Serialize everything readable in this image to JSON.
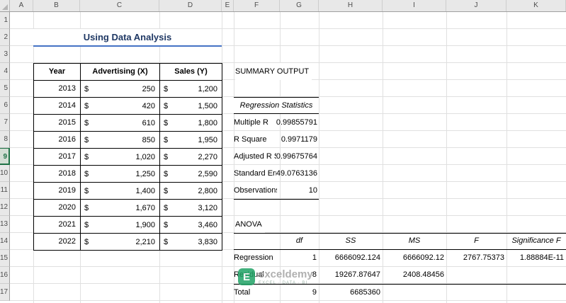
{
  "grid": {
    "columns": [
      "A",
      "B",
      "C",
      "D",
      "E",
      "F",
      "G",
      "H",
      "I",
      "J",
      "K"
    ],
    "rows": [
      "1",
      "2",
      "3",
      "4",
      "5",
      "6",
      "7",
      "8",
      "9",
      "10",
      "11",
      "12",
      "13",
      "14",
      "15",
      "16",
      "17"
    ],
    "selected_row": "9"
  },
  "title": "Using Data Analysis",
  "data_table": {
    "headers": [
      "Year",
      "Advertising (X)",
      "Sales (Y)"
    ],
    "currency": "$",
    "rows": [
      {
        "year": "2013",
        "advertising": "250",
        "sales": "1,200"
      },
      {
        "year": "2014",
        "advertising": "420",
        "sales": "1,500"
      },
      {
        "year": "2015",
        "advertising": "610",
        "sales": "1,800"
      },
      {
        "year": "2016",
        "advertising": "850",
        "sales": "1,950"
      },
      {
        "year": "2017",
        "advertising": "1,020",
        "sales": "2,270"
      },
      {
        "year": "2018",
        "advertising": "1,250",
        "sales": "2,590"
      },
      {
        "year": "2019",
        "advertising": "1,400",
        "sales": "2,800"
      },
      {
        "year": "2020",
        "advertising": "1,670",
        "sales": "3,120"
      },
      {
        "year": "2021",
        "advertising": "1,900",
        "sales": "3,460"
      },
      {
        "year": "2022",
        "advertising": "2,210",
        "sales": "3,830"
      }
    ]
  },
  "summary_output": {
    "title": "SUMMARY OUTPUT",
    "regression_statistics": {
      "title": "Regression Statistics",
      "items": [
        {
          "label": "Multiple R",
          "value": "0.99855791"
        },
        {
          "label": "R Square",
          "value": "0.9971179"
        },
        {
          "label": "Adjusted R Square",
          "value": "0.99675764"
        },
        {
          "label": "Standard Error",
          "value": "49.0763136"
        },
        {
          "label": "Observations",
          "value": "10"
        }
      ]
    },
    "anova": {
      "title": "ANOVA",
      "headers": [
        "df",
        "SS",
        "MS",
        "F",
        "Significance F"
      ],
      "rows": [
        {
          "label": "Regression",
          "df": "1",
          "ss": "6666092.124",
          "ms": "6666092.12",
          "f": "2767.75373",
          "significance_f": "1.88884E-11"
        },
        {
          "label": "Residual",
          "df": "8",
          "ss": "19267.87647",
          "ms": "2408.48456",
          "f": "",
          "significance_f": ""
        },
        {
          "label": "Total",
          "df": "9",
          "ss": "6685360",
          "ms": "",
          "f": "",
          "significance_f": ""
        }
      ]
    }
  },
  "watermark": {
    "logo_letter": "E",
    "name": "exceldemy",
    "tagline": "EXCEL · DATA · BI"
  },
  "colors": {
    "title_text": "#1F3864",
    "title_underline": "#4472C4",
    "brand_green": "#21A366",
    "selected_row_accent": "#1E7145"
  }
}
